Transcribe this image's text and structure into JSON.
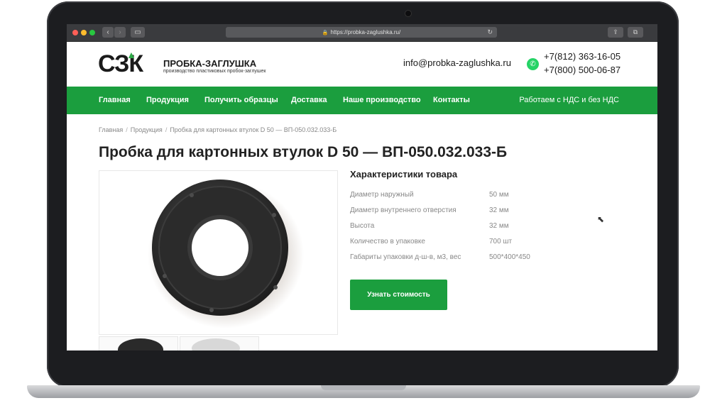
{
  "browser": {
    "url": "https://probka-zaglushka.ru/"
  },
  "header": {
    "logo_mark": "СЗК",
    "logo_name": "ПРОБКА-ЗАГЛУШКА",
    "logo_tagline": "производство пластиковых пробок-заглушек",
    "email": "info@probka-zaglushka.ru",
    "phone1": "+7(812) 363-16-05",
    "phone2": "+7(800) 500-06-87"
  },
  "nav": {
    "items": [
      "Главная",
      "Продукция",
      "Получить образцы",
      "Доставка",
      "Наше производство",
      "Контакты"
    ],
    "vat_note": "Работаем с НДС и без НДС"
  },
  "breadcrumb": [
    "Главная",
    "Продукция",
    "Пробка для картонных втулок D 50 — ВП-050.032.033-Б"
  ],
  "product": {
    "title": "Пробка для картонных втулок D 50 — ВП-050.032.033-Б",
    "specs_title": "Характеристики товара",
    "specs": [
      {
        "label": "Диаметр наружный",
        "value": "50 мм"
      },
      {
        "label": "Диаметр внутреннего отверстия",
        "value": "32 мм"
      },
      {
        "label": "Высота",
        "value": "32 мм"
      },
      {
        "label": "Количество в упаковке",
        "value": "700 шт"
      },
      {
        "label": "Габариты упаковки д-ш-в, м3, вес",
        "value": "500*400*450"
      }
    ],
    "price_button": "Узнать стоимость"
  },
  "icons": {
    "whatsapp": "whatsapp-icon",
    "lock": "lock-icon",
    "reload": "reload-icon"
  },
  "colors": {
    "brand_green": "#1b9e3e",
    "whatsapp_green": "#25d366"
  }
}
